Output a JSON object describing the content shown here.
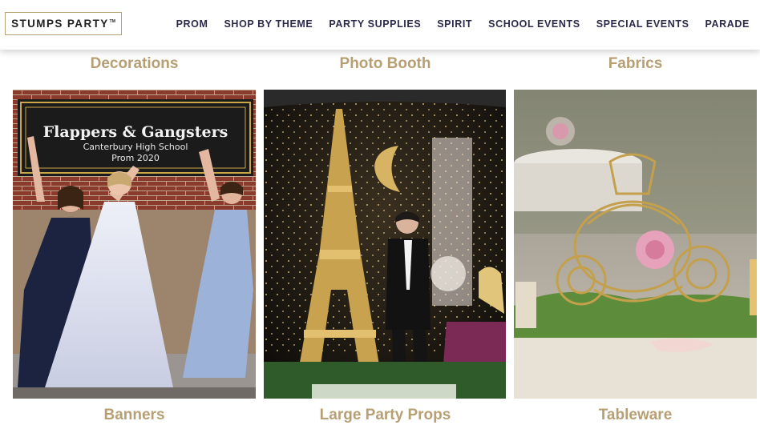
{
  "brand": {
    "name": "STUMPS PARTY",
    "trademark": "TM"
  },
  "nav": {
    "items": [
      {
        "label": "PROM"
      },
      {
        "label": "SHOP BY THEME"
      },
      {
        "label": "PARTY SUPPLIES"
      },
      {
        "label": "SPIRIT"
      },
      {
        "label": "SCHOOL EVENTS"
      },
      {
        "label": "SPECIAL EVENTS"
      },
      {
        "label": "PARADE"
      }
    ]
  },
  "top_categories": [
    "Decorations",
    "Photo Booth",
    "Fabrics"
  ],
  "tiles": [
    {
      "label": "Banners",
      "banner": {
        "line1": "Flappers & Gangsters",
        "line2": "Canterbury High School",
        "line3": "Prom 2020"
      }
    },
    {
      "label": "Large Party Props"
    },
    {
      "label": "Tableware"
    }
  ],
  "colors": {
    "accent_gold": "#b79f74",
    "nav_text": "#2c2a4a",
    "logo_border": "#b8a173"
  }
}
